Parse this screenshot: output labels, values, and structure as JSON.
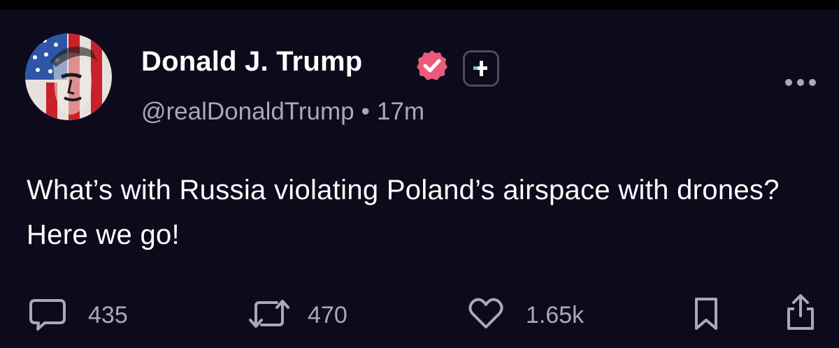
{
  "post": {
    "display_name": "Donald J. Trump",
    "handle": "@realDonaldTrump",
    "separator": "•",
    "time": "17m",
    "text": "What’s with Russia violating Poland’s airspace with drones? Here we go!",
    "verified_color": "#ec5a7d",
    "plus_badge_accent": "#5fd3c9"
  },
  "actions": {
    "replies": "435",
    "reposts": "470",
    "likes": "1.65k"
  },
  "icons": [
    "verified-badge-icon",
    "plus-badge-icon",
    "more-options-icon",
    "reply-icon",
    "repost-icon",
    "like-icon",
    "bookmark-icon",
    "share-icon"
  ]
}
